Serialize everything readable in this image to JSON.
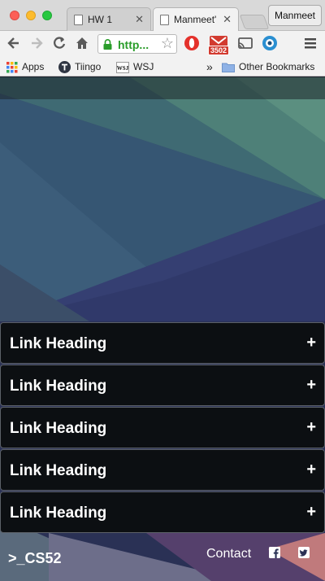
{
  "browser": {
    "tabs": [
      {
        "title": "HW 1",
        "active": false
      },
      {
        "title": "Manmeet'",
        "active": true
      }
    ],
    "profile_name": "Manmeet",
    "omnibox": {
      "url_display": "http..."
    },
    "extension_badge": "3502",
    "bookmarks": [
      {
        "label": "Apps",
        "icon": "apps-grid-icon"
      },
      {
        "label": "Tiingo",
        "icon": "tiingo-icon"
      },
      {
        "label": "WSJ",
        "icon": "wsj-icon"
      }
    ],
    "bookmarks_overflow": "»",
    "other_bookmarks": "Other Bookmarks",
    "colors": {
      "chrome_bg": "#f2f2f2",
      "url_green": "#2a9d2a",
      "badge_red": "#d23b30"
    }
  },
  "page": {
    "link_items": [
      {
        "label": "Link Heading",
        "expand_symbol": "+"
      },
      {
        "label": "Link Heading",
        "expand_symbol": "+"
      },
      {
        "label": "Link Heading",
        "expand_symbol": "+"
      },
      {
        "label": "Link Heading",
        "expand_symbol": "+"
      },
      {
        "label": "Link Heading",
        "expand_symbol": "+"
      }
    ],
    "footer": {
      "brand": ">_CS52",
      "contact_label": "Contact",
      "social_icons": [
        "facebook-icon",
        "twitter-icon"
      ]
    },
    "colors": {
      "link_bg": "#0c0f12",
      "link_text": "#ffffff"
    }
  }
}
